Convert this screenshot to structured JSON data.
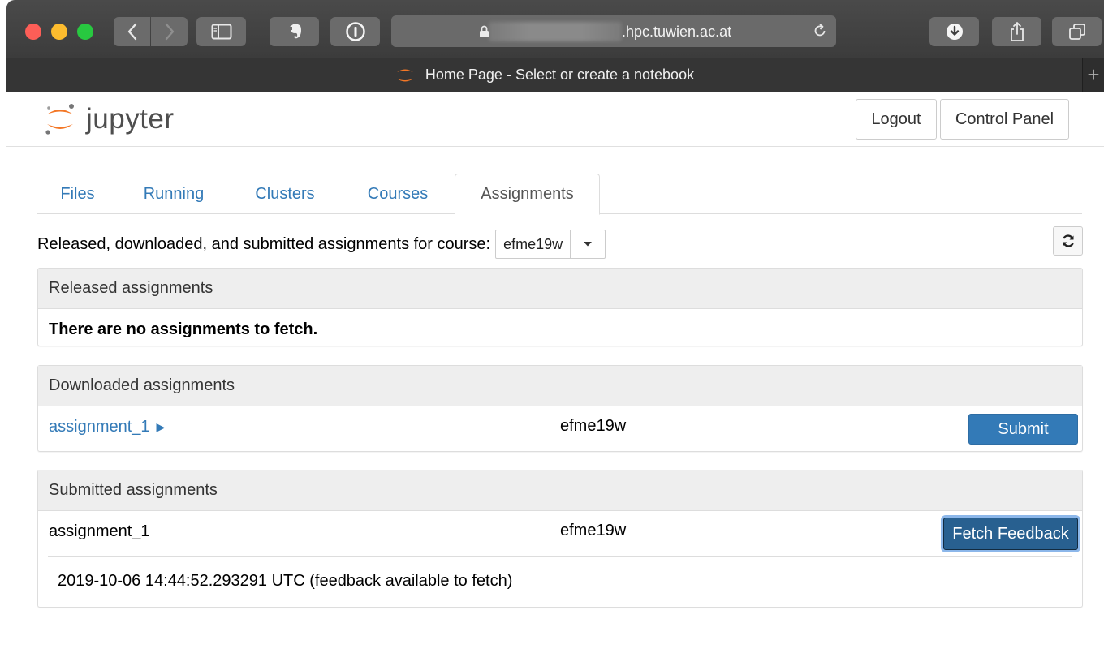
{
  "browser": {
    "url_host": ".hpc.tuwien.ac.at",
    "tab_title": "Home Page - Select or create a notebook",
    "new_tab_symbol": "+"
  },
  "header": {
    "logo_text": "jupyter",
    "logout_label": "Logout",
    "control_panel_label": "Control Panel"
  },
  "nav": {
    "tabs": [
      {
        "label": "Files",
        "active": false
      },
      {
        "label": "Running",
        "active": false
      },
      {
        "label": "Clusters",
        "active": false
      },
      {
        "label": "Courses",
        "active": false
      },
      {
        "label": "Assignments",
        "active": true
      }
    ]
  },
  "assignments": {
    "course_label": "Released, downloaded, and submitted assignments for course:",
    "course_selected": "efme19w",
    "released": {
      "heading": "Released assignments",
      "empty_message": "There are no assignments to fetch."
    },
    "downloaded": {
      "heading": "Downloaded assignments",
      "rows": [
        {
          "name": "assignment_1",
          "course": "efme19w",
          "action": "Submit"
        }
      ]
    },
    "submitted": {
      "heading": "Submitted assignments",
      "rows": [
        {
          "name": "assignment_1",
          "course": "efme19w",
          "action": "Fetch Feedback",
          "detail": "2019-10-06 14:44:52.293291 UTC (feedback available to fetch)"
        }
      ]
    }
  },
  "colors": {
    "link_blue": "#337ab7",
    "primary_button": "#337ab7",
    "focused_button": "#286090",
    "jupyter_orange": "#f37726"
  }
}
